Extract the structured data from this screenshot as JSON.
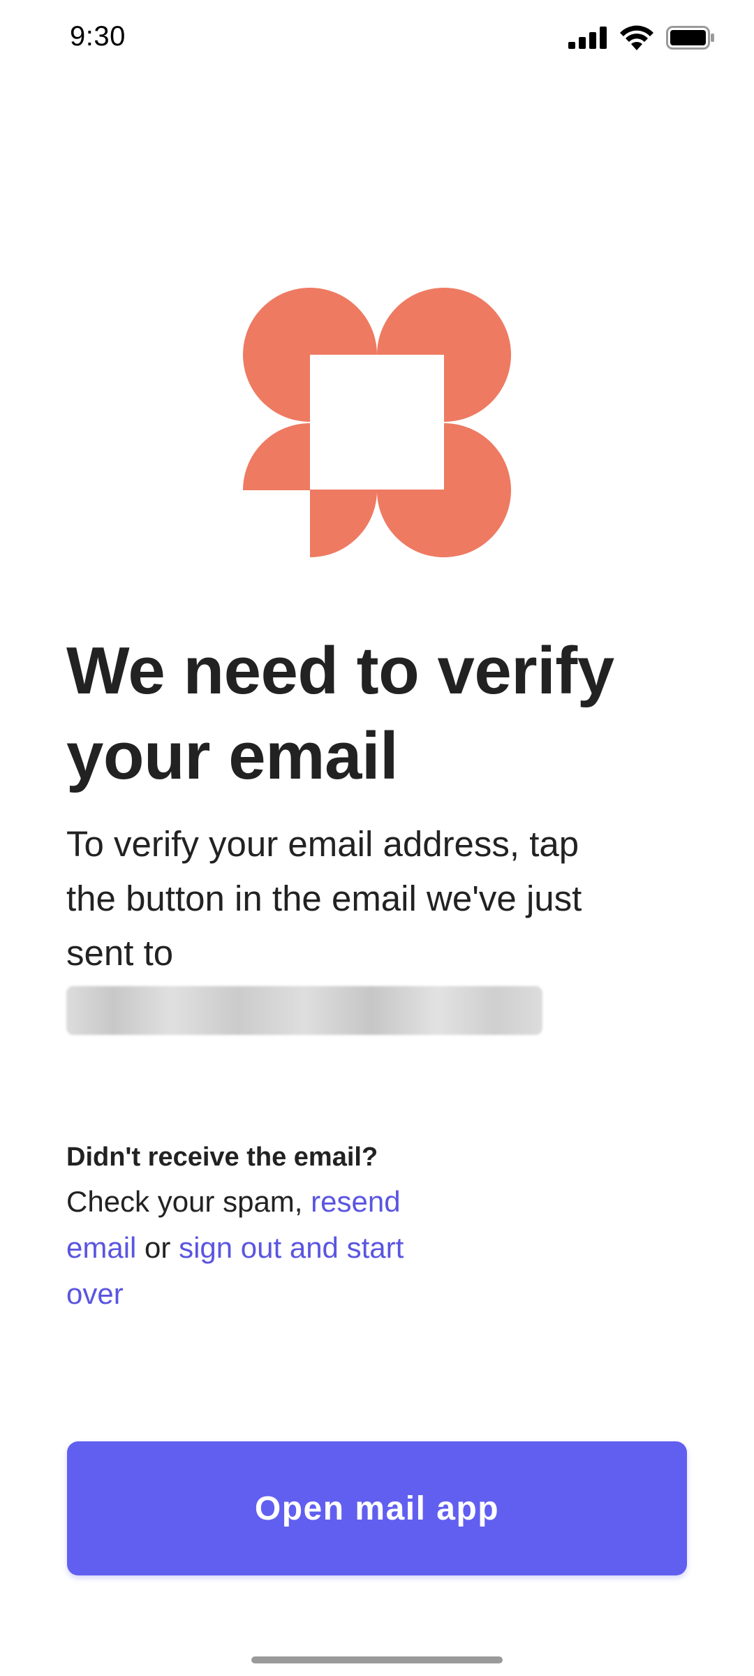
{
  "status_bar": {
    "time": "9:30",
    "icons": [
      "cellular-signal-icon",
      "wifi-icon",
      "battery-icon"
    ]
  },
  "logo": {
    "icon": "brand-logo-icon",
    "color": "#EE7A62"
  },
  "headline": "We need to verify your email",
  "body": {
    "text": "To verify your email address, tap the button in the email we've just sent to"
  },
  "help": {
    "heading": "Didn't receive the email?",
    "prefix": "Check your spam, ",
    "resend_link": "resend email",
    "middle": " or ",
    "signout_link": "sign out and start over"
  },
  "primary_button": {
    "label": "Open mail app",
    "color": "#615FF0"
  },
  "colors": {
    "accent": "#615FF0",
    "link": "#5A55E0",
    "brand": "#EE7A62",
    "text": "#222222"
  }
}
